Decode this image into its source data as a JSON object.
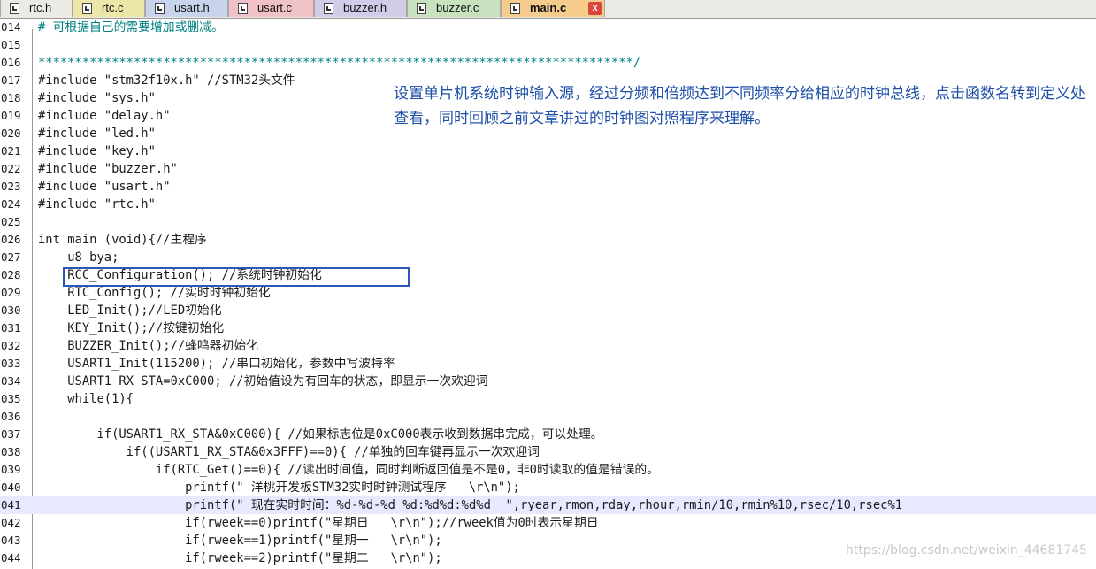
{
  "tabs": [
    {
      "label": "rtc.h",
      "active": false
    },
    {
      "label": "rtc.c",
      "active": false
    },
    {
      "label": "usart.h",
      "active": false
    },
    {
      "label": "usart.c",
      "active": false
    },
    {
      "label": "buzzer.h",
      "active": false
    },
    {
      "label": "buzzer.c",
      "active": false
    },
    {
      "label": "main.c",
      "active": true
    }
  ],
  "close_glyph": "x",
  "lines": [
    {
      "no": "014",
      "code": "# 可根据自己的需要增加或删减。"
    },
    {
      "no": "015",
      "code": ""
    },
    {
      "no": "016",
      "code": "*********************************************************************************/"
    },
    {
      "no": "017",
      "code": "#include \"stm32f10x.h\" //STM32头文件"
    },
    {
      "no": "018",
      "code": "#include \"sys.h\""
    },
    {
      "no": "019",
      "code": "#include \"delay.h\""
    },
    {
      "no": "020",
      "code": "#include \"led.h\""
    },
    {
      "no": "021",
      "code": "#include \"key.h\""
    },
    {
      "no": "022",
      "code": "#include \"buzzer.h\""
    },
    {
      "no": "023",
      "code": "#include \"usart.h\""
    },
    {
      "no": "024",
      "code": "#include \"rtc.h\""
    },
    {
      "no": "025",
      "code": ""
    },
    {
      "no": "026",
      "code": "int main (void){//主程序"
    },
    {
      "no": "027",
      "code": "    u8 bya;"
    },
    {
      "no": "028",
      "code": "    RCC_Configuration(); //系统时钟初始化"
    },
    {
      "no": "029",
      "code": "    RTC_Config(); //实时时钟初始化"
    },
    {
      "no": "030",
      "code": "    LED_Init();//LED初始化"
    },
    {
      "no": "031",
      "code": "    KEY_Init();//按键初始化"
    },
    {
      "no": "032",
      "code": "    BUZZER_Init();//蜂鸣器初始化"
    },
    {
      "no": "033",
      "code": "    USART1_Init(115200); //串口初始化，参数中写波特率"
    },
    {
      "no": "034",
      "code": "    USART1_RX_STA=0xC000; //初始值设为有回车的状态，即显示一次欢迎词"
    },
    {
      "no": "035",
      "code": "    while(1){"
    },
    {
      "no": "036",
      "code": ""
    },
    {
      "no": "037",
      "code": "        if(USART1_RX_STA&0xC000){ //如果标志位是0xC000表示收到数据串完成，可以处理。"
    },
    {
      "no": "038",
      "code": "            if((USART1_RX_STA&0x3FFF)==0){ //单独的回车键再显示一次欢迎词"
    },
    {
      "no": "039",
      "code": "                if(RTC_Get()==0){ //读出时间值，同时判断返回值是不是0，非0时读取的值是错误的。"
    },
    {
      "no": "040",
      "code": "                    printf(\" 洋桃开发板STM32实时时钟测试程序   \\r\\n\");"
    },
    {
      "no": "041",
      "code": "                    printf(\" 现在实时时间：%d-%d-%d %d:%d%d:%d%d  \",ryear,rmon,rday,rhour,rmin/10,rmin%10,rsec/10,rsec%1"
    },
    {
      "no": "042",
      "code": "                    if(rweek==0)printf(\"星期日   \\r\\n\");//rweek值为0时表示星期日"
    },
    {
      "no": "043",
      "code": "                    if(rweek==1)printf(\"星期一   \\r\\n\");"
    },
    {
      "no": "044",
      "code": "                    if(rweek==2)printf(\"星期二   \\r\\n\");"
    }
  ],
  "annotation": "设置单片机系统时钟输入源，经过分频和倍频达到不同频率分给相应的时钟总线，点击函数名转到定义处查看，同时回顾之前文章讲过的时钟图对照程序来理解。",
  "watermark": "https://blog.csdn.net/weixin_44681745",
  "colors": {
    "tab_rtc": "#eceae4",
    "tab_yellow": "#ece6a8",
    "tab_blue": "#c8d4ec",
    "tab_pink": "#f0c2c8",
    "tab_purple": "#d2cce8",
    "tab_green": "#c8e2c0",
    "tab_orange": "#f6cc8c",
    "annotation_text": "#1d4fa8",
    "highlight_box": "#2c57b8",
    "current_line": "#e8e8ff"
  }
}
